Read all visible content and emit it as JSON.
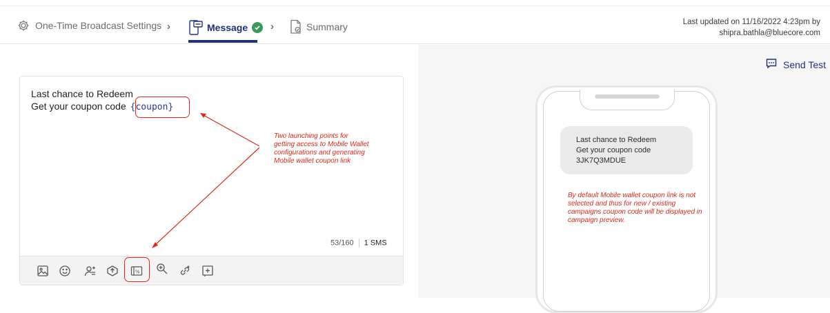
{
  "header": {
    "steps": [
      {
        "label": "One-Time Broadcast Settings",
        "icon": "gear-icon"
      },
      {
        "label": "Message",
        "icon": "sms-icon",
        "status": "complete"
      },
      {
        "label": "Summary",
        "icon": "document-check-icon"
      }
    ],
    "last_updated_line1": "Last updated on 11/16/2022 4:23pm by",
    "last_updated_line2": "shipra.bathla@bluecore.com"
  },
  "editor": {
    "line1": "Last chance to Redeem",
    "line2_prefix": "Get your coupon code ",
    "coupon_token": "{coupon}",
    "char_count": "53/160",
    "sms_count": "1 SMS",
    "toolbar_icons": [
      "image-icon",
      "emoji-icon",
      "personalization-icon",
      "product-icon",
      "coupon-icon",
      "search-icon",
      "link-icon",
      "add-icon"
    ]
  },
  "annotations": {
    "launch_points": "Two launching points for getting access to Mobile Wallet configurations and generating Mobile wallet coupon link",
    "default_note": "By default Mobile wallet coupon link is not selected and thus for new / existing campaigns coupon code will be displayed in campaign preview."
  },
  "preview": {
    "send_test_label": "Send Test",
    "line1": "Last chance to Redeem",
    "line2": "Get your coupon code",
    "coupon_code": "3JK7Q3MDUE"
  },
  "colors": {
    "accent": "#23307a",
    "success": "#3b9a5b",
    "annotation": "#e0271b",
    "preview_bg": "#f6f6f6"
  }
}
